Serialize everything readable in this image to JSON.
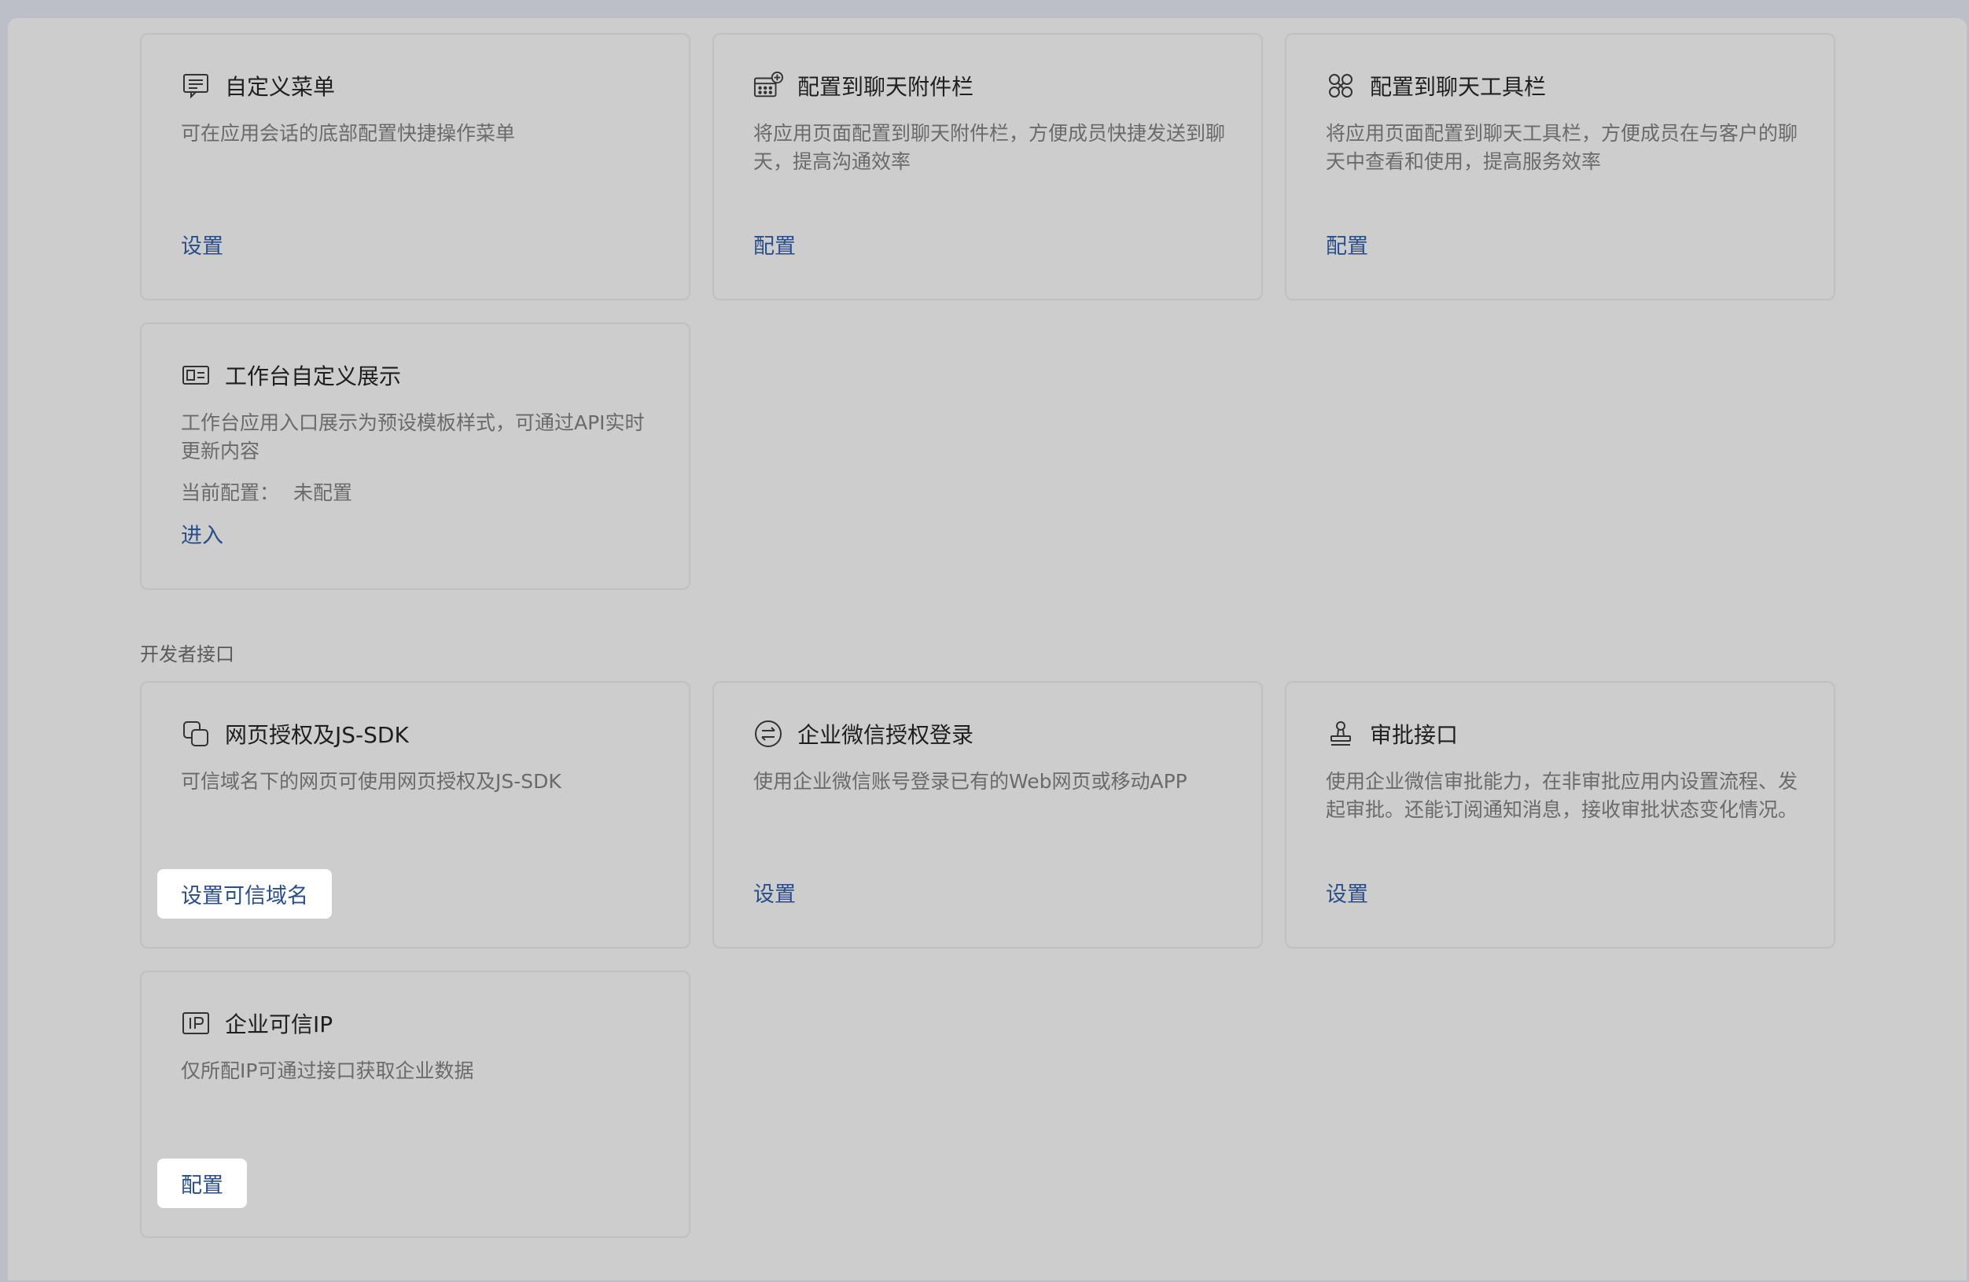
{
  "cards_top": [
    {
      "icon": "menu-message-icon",
      "title": "自定义菜单",
      "desc": "可在应用会话的底部配置快捷操作菜单",
      "action": "设置"
    },
    {
      "icon": "attachment-grid-plus-icon",
      "title": "配置到聊天附件栏",
      "desc": "将应用页面配置到聊天附件栏，方便成员快捷发送到聊天，提高沟通效率",
      "action": "配置"
    },
    {
      "icon": "toolbar-clover-icon",
      "title": "配置到聊天工具栏",
      "desc": "将应用页面配置到聊天工具栏，方便成员在与客户的聊天中查看和使用，提高服务效率",
      "action": "配置"
    },
    {
      "icon": "workbench-card-icon",
      "title": "工作台自定义展示",
      "desc": "工作台应用入口展示为预设模板样式，可通过API实时更新内容",
      "config_label": "当前配置：",
      "config_value": "未配置",
      "action": "进入"
    }
  ],
  "developer_section": {
    "label": "开发者接口",
    "cards": [
      {
        "icon": "web-auth-icon",
        "title": "网页授权及JS-SDK",
        "desc": "可信域名下的网页可使用网页授权及JS-SDK",
        "action": "设置可信域名"
      },
      {
        "icon": "wecom-login-icon",
        "title": "企业微信授权登录",
        "desc": "使用企业微信账号登录已有的Web网页或移动APP",
        "action": "设置"
      },
      {
        "icon": "approval-stamp-icon",
        "title": "审批接口",
        "desc": "使用企业微信审批能力，在非审批应用内设置流程、发起审批。还能订阅通知消息，接收审批状态变化情况。",
        "action": "设置"
      },
      {
        "icon": "ip-icon",
        "title": "企业可信IP",
        "desc": "仅所配IP可通过接口获取企业数据",
        "action": "配置"
      }
    ]
  }
}
